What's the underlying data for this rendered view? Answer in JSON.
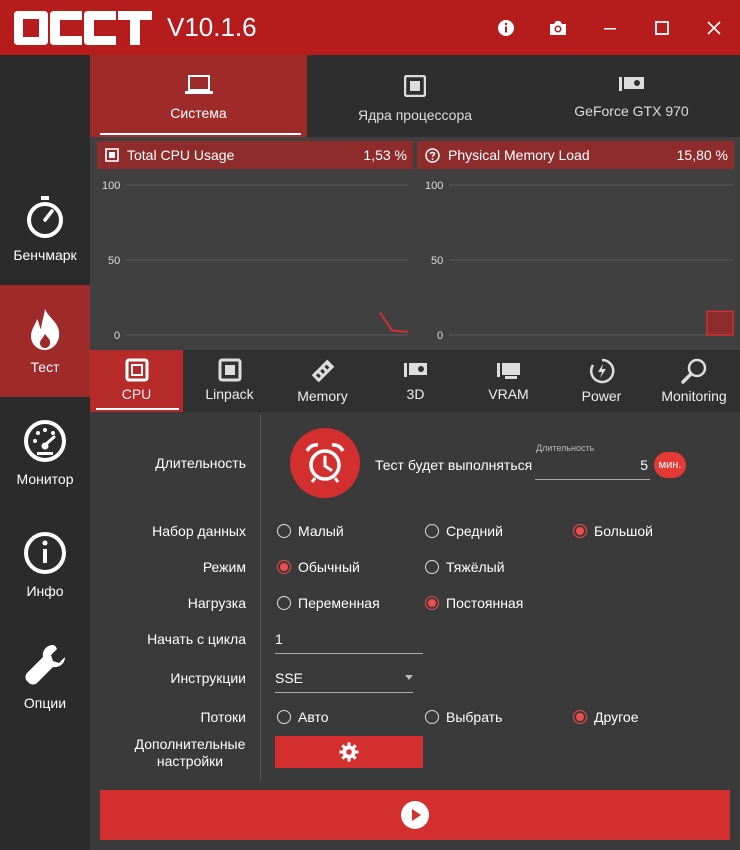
{
  "app": {
    "logo_text": "OCCT",
    "version": "V10.1.6"
  },
  "titlebar": {
    "buttons": [
      "info-icon",
      "camera-icon",
      "minimize-icon",
      "maximize-icon",
      "close-icon"
    ]
  },
  "sidebar": {
    "items": [
      {
        "label": "Бенчмарк",
        "icon": "stopwatch-icon"
      },
      {
        "label": "Тест",
        "icon": "flame-icon",
        "active": true
      },
      {
        "label": "Монитор",
        "icon": "gauge-icon"
      },
      {
        "label": "Инфо",
        "icon": "info-circle-icon"
      },
      {
        "label": "Опции",
        "icon": "wrench-icon"
      }
    ]
  },
  "top_tabs": [
    {
      "label": "Система",
      "icon": "laptop-icon",
      "active": true
    },
    {
      "label": "Ядра процессора",
      "icon": "cpu-chip-icon"
    },
    {
      "label": "GeForce GTX 970",
      "icon": "gpu-icon"
    }
  ],
  "graphs": [
    {
      "title": "Total CPU Usage",
      "value": "1,53 %",
      "icon": "cpu-square-icon",
      "y_ticks": [
        "100",
        "50",
        "0"
      ]
    },
    {
      "title": "Physical Memory Load",
      "value": "15,80 %",
      "icon": "question-circle-icon",
      "y_ticks": [
        "100",
        "50",
        "0"
      ]
    }
  ],
  "chart_data": [
    {
      "type": "line",
      "title": "Total CPU Usage",
      "ylim": [
        0,
        100
      ],
      "y_ticks": [
        100,
        50,
        0
      ],
      "values": [
        15,
        3,
        2
      ],
      "grid": true
    },
    {
      "type": "area",
      "title": "Physical Memory Load",
      "ylim": [
        0,
        100
      ],
      "y_ticks": [
        100,
        50,
        0
      ],
      "values": [
        15.8,
        15.8
      ],
      "grid": true
    }
  ],
  "sub_tabs": [
    {
      "label": "CPU",
      "icon": "cpu-square-icon",
      "active": true
    },
    {
      "label": "Linpack",
      "icon": "linpack-icon"
    },
    {
      "label": "Memory",
      "icon": "memory-stick-icon"
    },
    {
      "label": "3D",
      "icon": "gpu-icon"
    },
    {
      "label": "VRAM",
      "icon": "vram-icon"
    },
    {
      "label": "Power",
      "icon": "power-icon"
    },
    {
      "label": "Monitoring",
      "icon": "magnifier-icon"
    }
  ],
  "form": {
    "duration_label": "Длительность",
    "duration_text": "Тест будет выполняться",
    "duration_field_label": "Длительность",
    "duration_value": "5",
    "duration_unit": "мин.",
    "dataset_label": "Набор данных",
    "dataset_options": [
      {
        "label": "Малый",
        "checked": false
      },
      {
        "label": "Средний",
        "checked": false
      },
      {
        "label": "Большой",
        "checked": true
      }
    ],
    "mode_label": "Режим",
    "mode_options": [
      {
        "label": "Обычный",
        "checked": true
      },
      {
        "label": "Тяжёлый",
        "checked": false
      }
    ],
    "load_label": "Нагрузка",
    "load_options": [
      {
        "label": "Переменная",
        "checked": false
      },
      {
        "label": "Постоянная",
        "checked": true
      }
    ],
    "start_cycle_label": "Начать с цикла",
    "start_cycle_value": "1",
    "instructions_label": "Инструкции",
    "instructions_value": "SSE",
    "threads_label": "Потоки",
    "threads_options": [
      {
        "label": "Авто",
        "checked": false
      },
      {
        "label": "Выбрать",
        "checked": false
      },
      {
        "label": "Другое",
        "checked": true
      }
    ],
    "advanced_label_1": "Дополнительные",
    "advanced_label_2": "настройки"
  },
  "colors": {
    "brand_red": "#b71c1c",
    "accent_red": "#d32f2f",
    "active_tab": "#9e2a2a",
    "background": "#3a3a3a"
  }
}
